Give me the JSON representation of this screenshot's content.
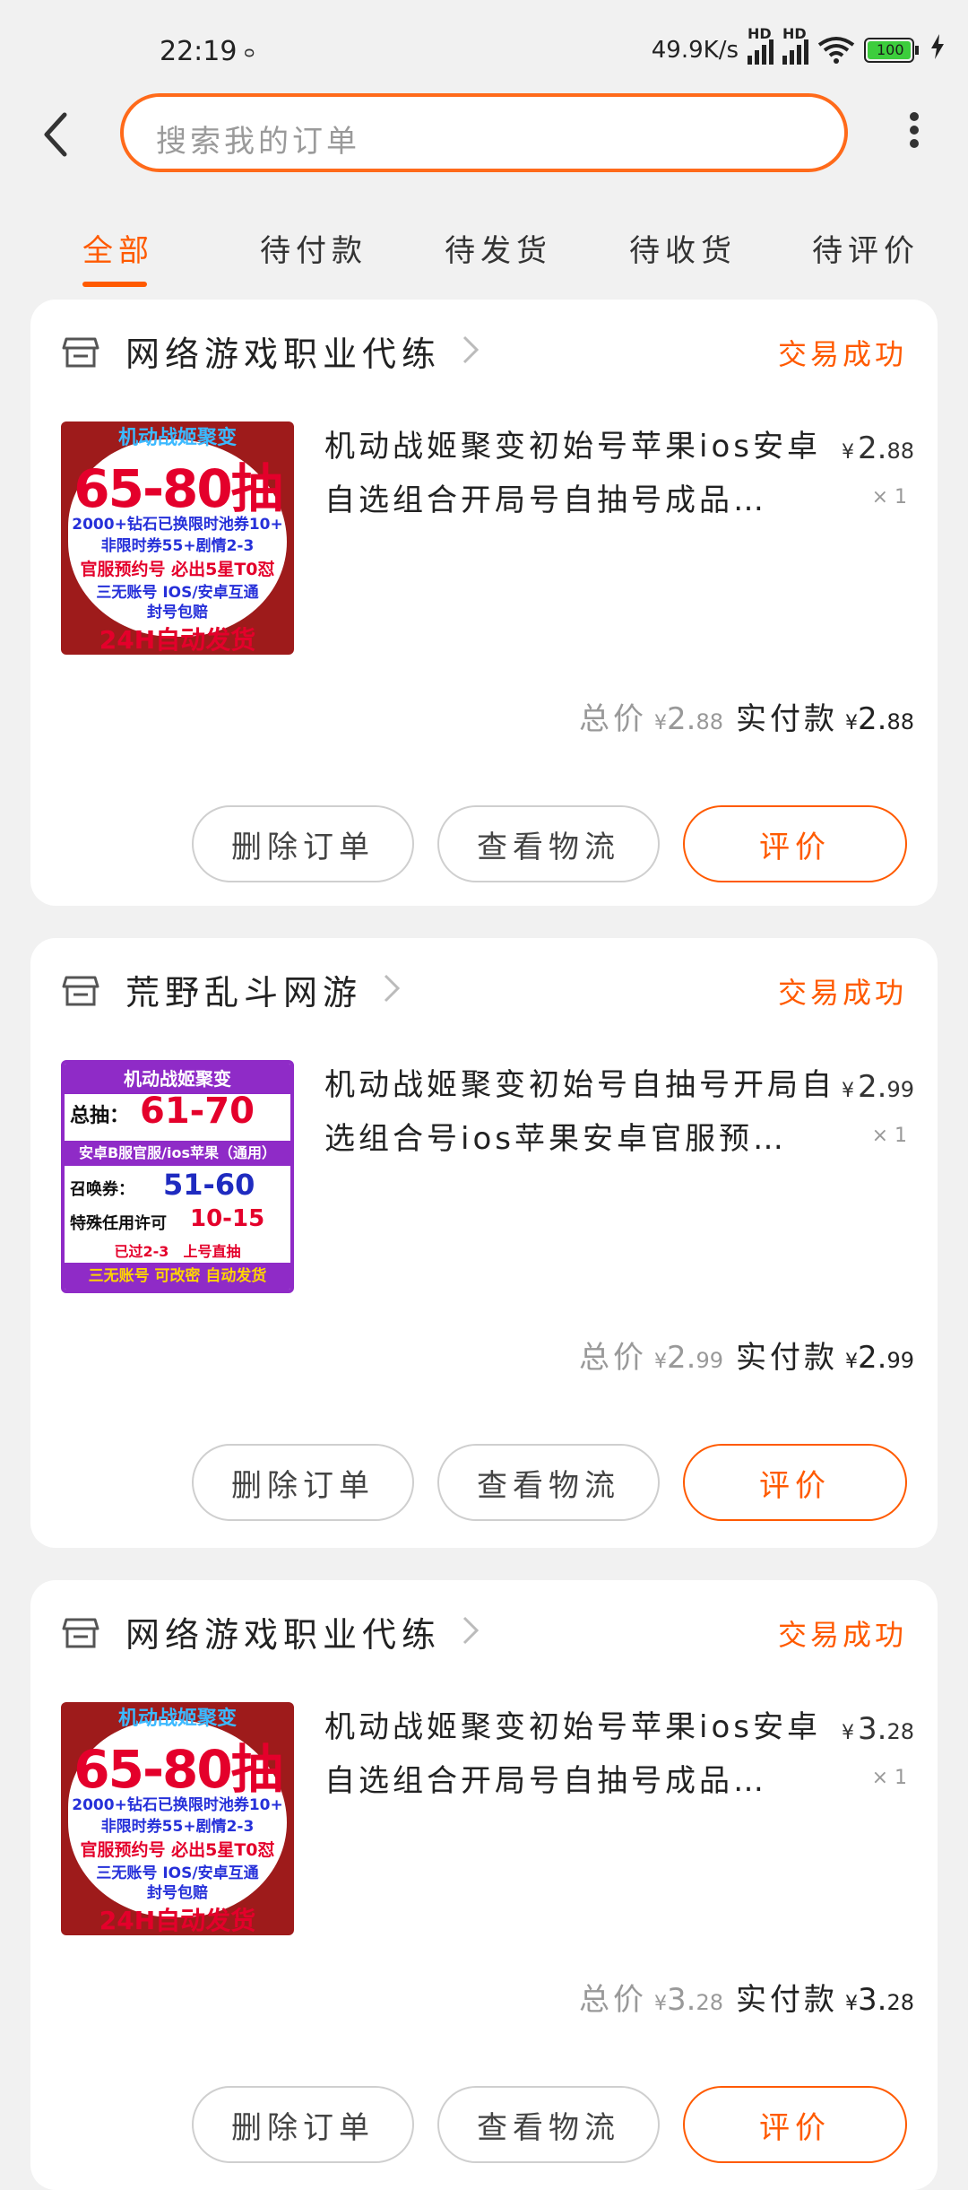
{
  "status_bar": {
    "time": "22:19",
    "indicator": "ᴑ",
    "network_speed": "49.9K/s",
    "signal_badge": "HD",
    "battery": "100"
  },
  "search": {
    "placeholder": "搜索我的订单",
    "accent_color": "#ff6a1a"
  },
  "tabs": [
    {
      "label": "全部",
      "active": true
    },
    {
      "label": "待付款",
      "active": false
    },
    {
      "label": "待发货",
      "active": false
    },
    {
      "label": "待收货",
      "active": false
    },
    {
      "label": "待评价",
      "active": false
    }
  ],
  "orders": [
    {
      "store": "网络游戏职业代练",
      "status": "交易成功",
      "title": "机动战姬聚变初始号苹果ios安卓自选组合开局号自抽号成品…",
      "unit_price_int": "2.",
      "unit_price_dec": "88",
      "qty": "× 1",
      "total_label": "总价",
      "total_int": "2.",
      "total_dec": "88",
      "paid_label": "实付款",
      "paid_int": "2.",
      "paid_dec": "88",
      "currency": "¥",
      "buttons": {
        "delete": "删除订单",
        "logistics": "查看物流",
        "review": "评价"
      },
      "thumb": {
        "type": "a",
        "lines": [
          "机动战姬聚变",
          "65-80抽",
          "2000+钻石已换限时池券10+",
          "非限时券55+剧情2-3",
          "官服预约号 必出5星T0怼",
          "三无账号 IOS/安卓互通",
          "封号包赔",
          "24H自动发货"
        ]
      }
    },
    {
      "store": "荒野乱斗网游",
      "status": "交易成功",
      "title": "机动战姬聚变初始号自抽号开局自选组合号ios苹果安卓官服预…",
      "unit_price_int": "2.",
      "unit_price_dec": "99",
      "qty": "× 1",
      "total_label": "总价",
      "total_int": "2.",
      "total_dec": "99",
      "paid_label": "实付款",
      "paid_int": "2.",
      "paid_dec": "99",
      "currency": "¥",
      "buttons": {
        "delete": "删除订单",
        "logistics": "查看物流",
        "review": "评价"
      },
      "thumb": {
        "type": "b",
        "lines": [
          "机动战姬聚变",
          "总抽：",
          "61-70",
          "安卓B服官服/ios苹果（通用）",
          "召唤券：",
          "51-60",
          "特殊任用许可",
          "10-15",
          "已过2-3　上号直抽",
          "三无账号 可改密 自动发货"
        ]
      }
    },
    {
      "store": "网络游戏职业代练",
      "status": "交易成功",
      "title": "机动战姬聚变初始号苹果ios安卓自选组合开局号自抽号成品…",
      "unit_price_int": "3.",
      "unit_price_dec": "28",
      "qty": "× 1",
      "total_label": "总价",
      "total_int": "3.",
      "total_dec": "28",
      "paid_label": "实付款",
      "paid_int": "3.",
      "paid_dec": "28",
      "currency": "¥",
      "buttons": {
        "delete": "删除订单",
        "logistics": "查看物流",
        "review": "评价"
      },
      "thumb": {
        "type": "a",
        "lines": [
          "机动战姬聚变",
          "65-80抽",
          "2000+钻石已换限时池券10+",
          "非限时券55+剧情2-3",
          "官服预约号 必出5星T0怼",
          "三无账号 IOS/安卓互通",
          "封号包赔",
          "24H自动发货"
        ]
      }
    }
  ]
}
